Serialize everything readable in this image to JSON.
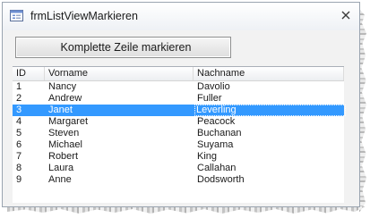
{
  "window": {
    "title": "frmListViewMarkieren"
  },
  "button": {
    "label": "Komplette Zeile markieren"
  },
  "listview": {
    "columns": [
      "ID",
      "Vorname",
      "Nachname"
    ],
    "selected_row_index": 2,
    "selection_color": "#3399ff",
    "rows": [
      {
        "id": "1",
        "vorname": "Nancy",
        "nachname": "Davolio"
      },
      {
        "id": "2",
        "vorname": "Andrew",
        "nachname": "Fuller"
      },
      {
        "id": "3",
        "vorname": "Janet",
        "nachname": "Leverling"
      },
      {
        "id": "4",
        "vorname": "Margaret",
        "nachname": "Peacock"
      },
      {
        "id": "5",
        "vorname": "Steven",
        "nachname": "Buchanan"
      },
      {
        "id": "6",
        "vorname": "Michael",
        "nachname": "Suyama"
      },
      {
        "id": "7",
        "vorname": "Robert",
        "nachname": "King"
      },
      {
        "id": "8",
        "vorname": "Laura",
        "nachname": "Callahan"
      },
      {
        "id": "9",
        "vorname": "Anne",
        "nachname": "Dodsworth"
      }
    ]
  },
  "icons": {
    "window": "form-window-icon",
    "close": "close-icon"
  }
}
